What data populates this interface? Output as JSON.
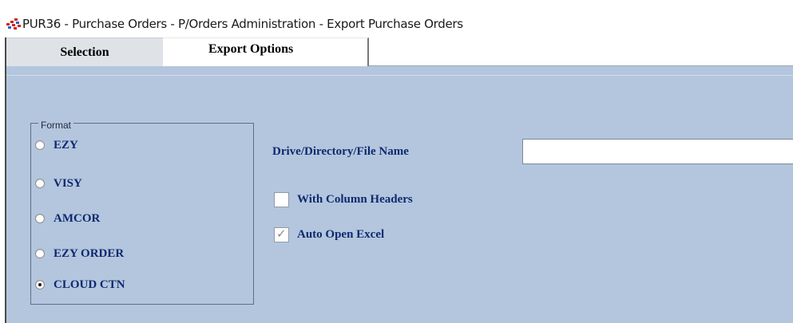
{
  "window": {
    "title": "PUR36 - Purchase Orders - P/Orders Administration - Export Purchase Orders",
    "icon": "app-logo-icon"
  },
  "tabs": [
    {
      "label": "Selection",
      "active": false
    },
    {
      "label": "Export Options",
      "active": true
    }
  ],
  "format_group": {
    "legend": "Format",
    "options": [
      {
        "label": "EZY",
        "checked": false
      },
      {
        "label": "VISY",
        "checked": false
      },
      {
        "label": "AMCOR",
        "checked": false
      },
      {
        "label": "EZY ORDER",
        "checked": false
      },
      {
        "label": "CLOUD CTN",
        "checked": true
      }
    ]
  },
  "file_name": {
    "label": "Drive/Directory/File Name",
    "value": ""
  },
  "checkboxes": [
    {
      "label": "With Column Headers",
      "checked": false
    },
    {
      "label": "Auto Open Excel",
      "checked": true
    }
  ],
  "colors": {
    "panel_bg": "#b4c6de",
    "label_text": "#0e2a6e",
    "tab_inactive_bg": "#dfe3e8"
  }
}
